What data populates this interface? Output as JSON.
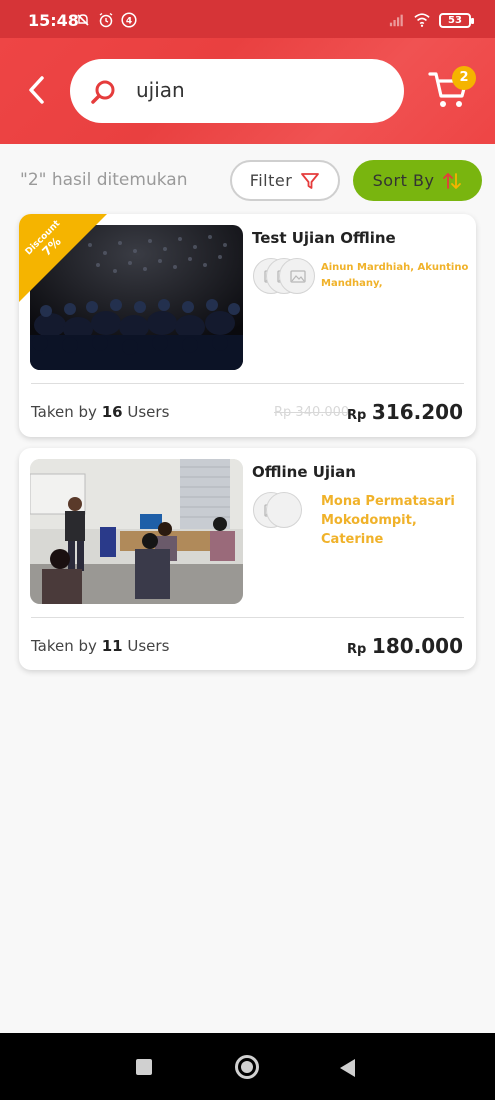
{
  "status_bar": {
    "time": "15:48",
    "notification_count": "4",
    "battery": "53"
  },
  "header": {
    "search_value": "ujian",
    "cart_count": "2"
  },
  "results": {
    "count_text": "\"2\" hasil ditemukan",
    "filter_label": "Filter",
    "sort_label": "Sort By"
  },
  "courses": [
    {
      "title": "Test Ujian Offline",
      "authors_line1": "Ainun Mardhiah, Akuntino",
      "authors_line2": "Mandhany,",
      "discount_label": "Discount",
      "discount_value": "7%",
      "taken_prefix": "Taken by",
      "taken_count": "16",
      "taken_suffix": "Users",
      "old_price": "Rp 340.000",
      "price_currency": "Rp",
      "price_amount": "316.200"
    },
    {
      "title": "Offline Ujian",
      "authors_line1": "Mona Permatasari",
      "authors_line2": "Mokodompit, Caterine",
      "taken_prefix": "Taken by",
      "taken_count": "11",
      "taken_suffix": "Users",
      "price_currency": "Rp",
      "price_amount": "180.000"
    }
  ],
  "colors": {
    "header": "#ee4545",
    "status_bar": "#d63437",
    "sort_button": "#79b50f",
    "accent_yellow": "#f5b400",
    "author_text": "#f0b22a"
  }
}
